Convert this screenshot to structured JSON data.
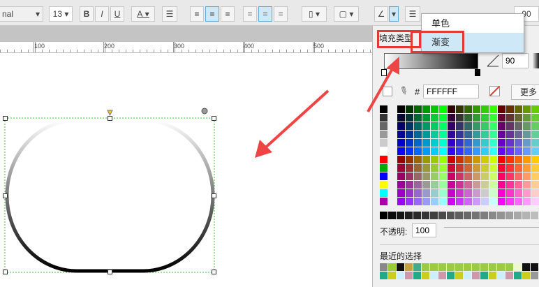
{
  "toolbar": {
    "font_name": "nal",
    "font_size": "13",
    "bold": "B",
    "italic": "I",
    "underline": "U",
    "font_color": "A",
    "field_right": "90"
  },
  "ruler": {
    "labels": [
      "100",
      "200",
      "300",
      "400",
      "500"
    ]
  },
  "menu": {
    "items": [
      "单色",
      "渐变"
    ],
    "selected": "渐变"
  },
  "panel": {
    "fill_type_label": "填充类型",
    "angle": "90",
    "hex_prefix": "#",
    "hex_value": "FFFFFF",
    "more_button": "更多",
    "opacity_label": "不透明:",
    "opacity_value": "100",
    "recent_label": "最近的选择"
  },
  "colors": {
    "accent_red": "#e53935",
    "highlight": "#cfe8f7",
    "selection_green": "#3fbf3f"
  }
}
